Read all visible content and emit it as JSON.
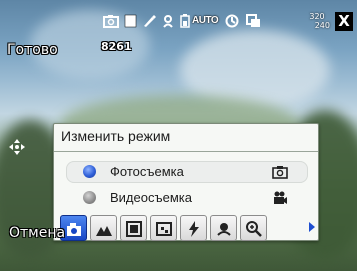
{
  "status": {
    "ready_label": "Готово",
    "shots_remaining": "8261",
    "resolution_top": "320",
    "resolution_bottom": "240",
    "close_label": "X",
    "mode_indicator_text": "AUTO"
  },
  "dialog": {
    "title": "Изменить режим",
    "options": [
      {
        "label": "Фотосъемка",
        "selected": true,
        "icon": "camera-icon"
      },
      {
        "label": "Видеосъемка",
        "selected": false,
        "icon": "video-camera-icon"
      }
    ]
  },
  "softkeys": {
    "left_label": "Отмена"
  },
  "toolbar": {
    "buttons": [
      {
        "icon": "photo-mode-icon",
        "active": true
      },
      {
        "icon": "landscape-icon",
        "active": false
      },
      {
        "icon": "frame-icon",
        "active": false
      },
      {
        "icon": "scene-icon",
        "active": false
      },
      {
        "icon": "flash-icon",
        "active": false
      },
      {
        "icon": "macro-flower-icon",
        "active": false
      },
      {
        "icon": "zoom-icon",
        "active": false
      }
    ]
  },
  "colors": {
    "accent": "#1f4fd0",
    "dialog_bg": "#f6f8f5"
  }
}
